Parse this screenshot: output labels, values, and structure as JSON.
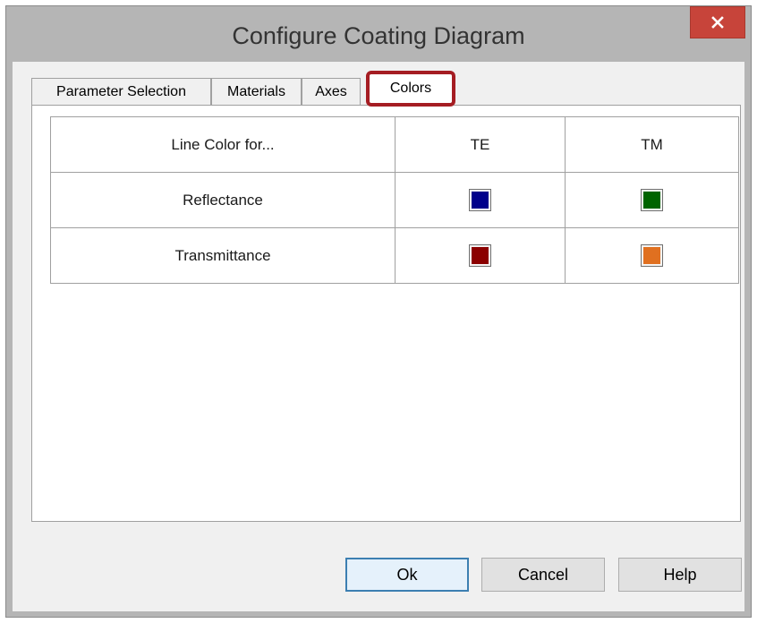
{
  "window": {
    "title": "Configure Coating Diagram",
    "close_icon": "close-icon"
  },
  "tabs": [
    {
      "label": "Parameter Selection",
      "active": false
    },
    {
      "label": "Materials",
      "active": false
    },
    {
      "label": "Axes",
      "active": false
    },
    {
      "label": "Colors",
      "active": true
    }
  ],
  "table": {
    "headers": [
      "Line Color for...",
      "TE",
      "TM"
    ],
    "rows": [
      {
        "label": "Reflectance",
        "te_color": "#00008b",
        "tm_color": "#006400"
      },
      {
        "label": "Transmittance",
        "te_color": "#8b0000",
        "tm_color": "#e07020"
      }
    ]
  },
  "buttons": {
    "ok": "Ok",
    "cancel": "Cancel",
    "help": "Help"
  },
  "colors": {
    "highlight": "#a51d23",
    "close_button": "#c7443a"
  }
}
